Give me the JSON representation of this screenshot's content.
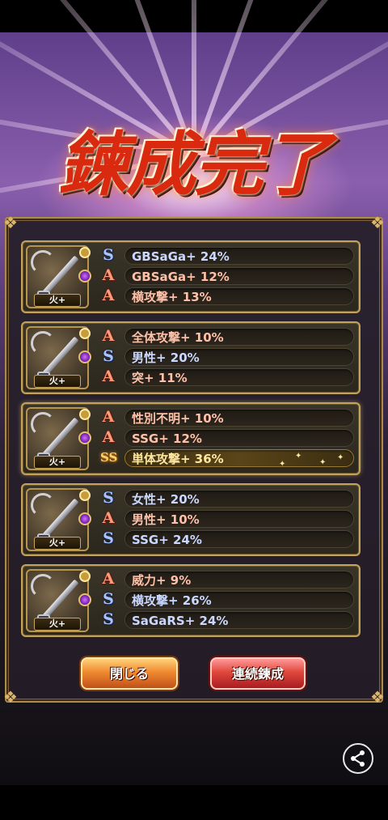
{
  "screen_title": "鍊成完了",
  "items": [
    {
      "element": "火+",
      "highlight": false,
      "gem": "purple",
      "stats": [
        {
          "rank": "S",
          "text": "GBSaGa+ 24%"
        },
        {
          "rank": "A",
          "text": "GBSaGa+ 12%"
        },
        {
          "rank": "A",
          "text": "横攻撃+ 13%"
        }
      ]
    },
    {
      "element": "火+",
      "highlight": false,
      "gem": "purple",
      "stats": [
        {
          "rank": "A",
          "text": "全体攻撃+ 10%"
        },
        {
          "rank": "S",
          "text": "男性+ 20%"
        },
        {
          "rank": "A",
          "text": "突+ 11%"
        }
      ]
    },
    {
      "element": "火+",
      "highlight": true,
      "gem": "purple",
      "stats": [
        {
          "rank": "A",
          "text": "性別不明+ 10%"
        },
        {
          "rank": "A",
          "text": "SSG+ 12%"
        },
        {
          "rank": "SS",
          "text": "単体攻撃+ 36%"
        }
      ]
    },
    {
      "element": "火+",
      "highlight": false,
      "gem": "purple",
      "stats": [
        {
          "rank": "S",
          "text": "女性+ 20%"
        },
        {
          "rank": "A",
          "text": "男性+ 10%"
        },
        {
          "rank": "S",
          "text": "SSG+ 24%"
        }
      ]
    },
    {
      "element": "火+",
      "highlight": false,
      "gem": "purple",
      "stats": [
        {
          "rank": "A",
          "text": "威力+ 9%"
        },
        {
          "rank": "S",
          "text": "横攻撃+ 26%"
        },
        {
          "rank": "S",
          "text": "SaGaRS+ 24%"
        }
      ]
    }
  ],
  "rank_glyphs": {
    "A": "A",
    "S": "S",
    "SS": "SS"
  },
  "buttons": {
    "close": "閉じる",
    "continue": "連続鍊成"
  },
  "icons": {
    "share": "share-icon"
  },
  "colors": {
    "rank_A": "#ff9a7a",
    "rank_S": "#a8c4ff",
    "rank_SS": "#ffd06a",
    "frame_gold": "#c3a35a"
  }
}
